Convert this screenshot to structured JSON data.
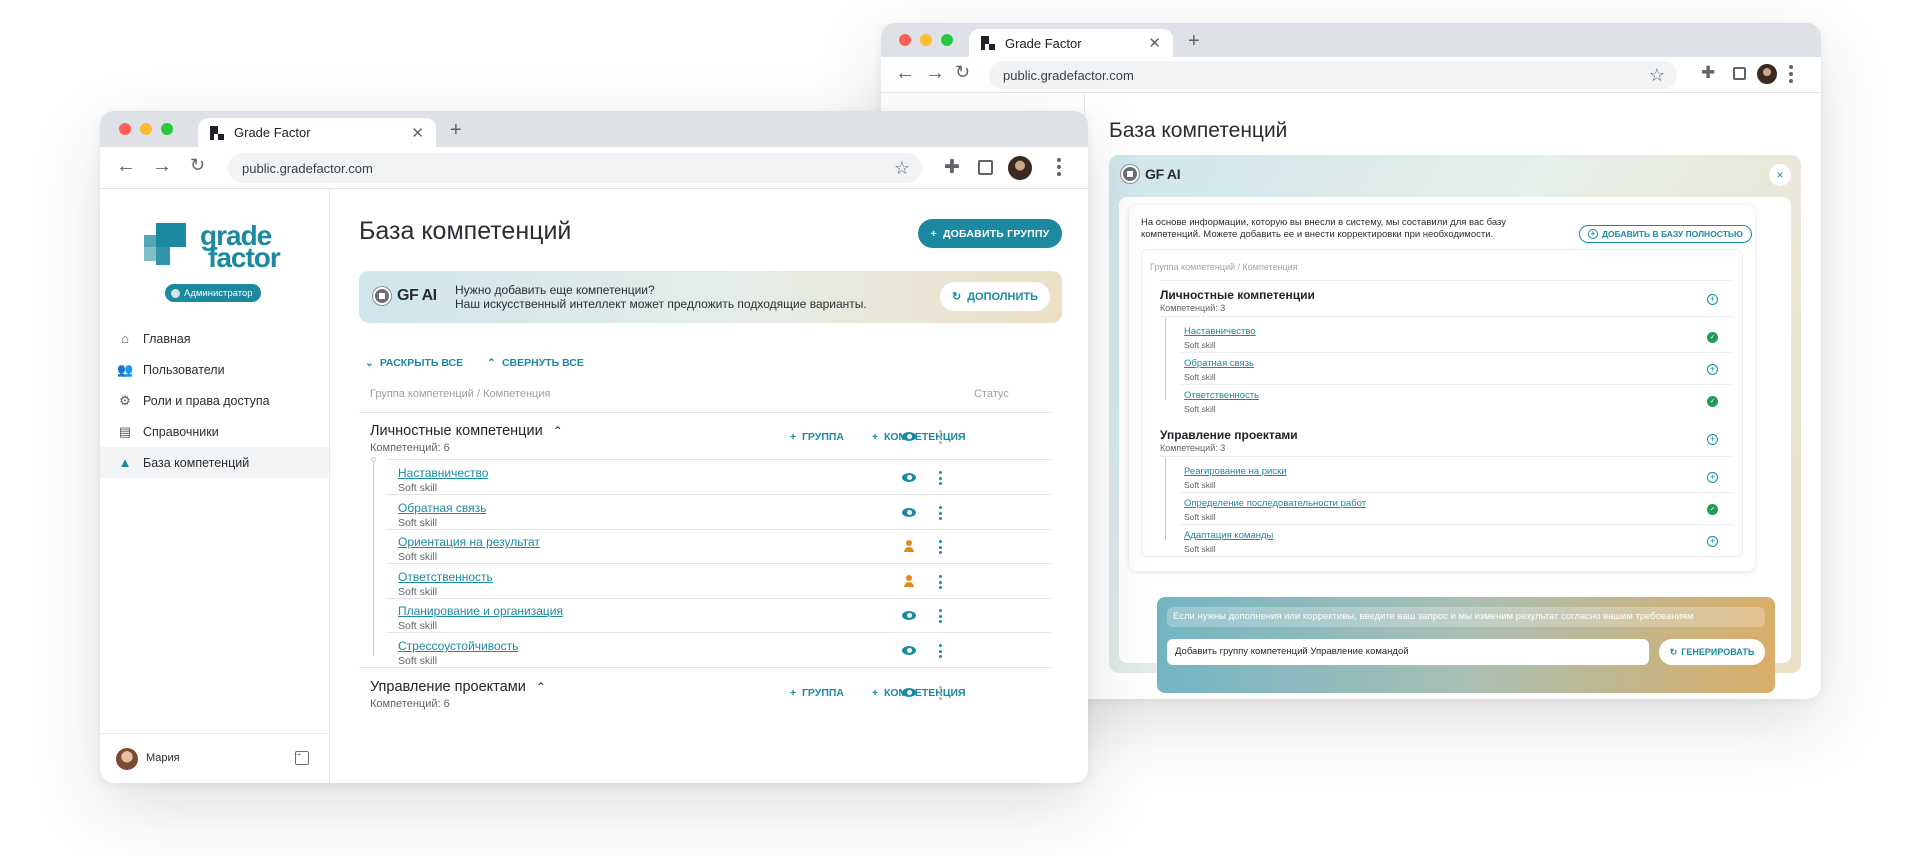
{
  "colors": {
    "accent": "#1b8aa1",
    "orange": "#e08a1e",
    "ok": "#1f9d55"
  },
  "back_window": {
    "tab_title": "Grade Factor",
    "url": "public.gradefactor.com",
    "page_title": "База компетенций",
    "ai_label": "GF AI",
    "close": "×",
    "intro": "На основе информации, которую вы внесли в систему,  мы составили для вас базу компетенций. Можете добавить ее и внести корректировки при необходимости.",
    "add_all_btn": "ДОБАВИТЬ В БАЗУ ПОЛНОСТЬЮ",
    "table_head": "Группа компетенций / Компетенция",
    "groups": [
      {
        "title": "Личностные компетенции",
        "count": "Компетенций: 3",
        "items": [
          {
            "name": "Наставничество",
            "sub": "Soft skill",
            "state": "ok"
          },
          {
            "name": "Обратная связь",
            "sub": "Soft skill",
            "state": "add"
          },
          {
            "name": "Ответственность",
            "sub": "Soft skill",
            "state": "ok"
          }
        ]
      },
      {
        "title": "Управление проектами",
        "count": "Компетенций: 3",
        "items": [
          {
            "name": "Реагирование на риски",
            "sub": "Soft skill",
            "state": "add"
          },
          {
            "name": "Определение последовательности работ",
            "sub": "Soft skill",
            "state": "ok"
          },
          {
            "name": "Адаптация команды",
            "sub": "Soft skill",
            "state": "add"
          }
        ]
      }
    ],
    "prompt_hint": "Если нужны дополнения или коррективы, введите ваш запрос и мы изменим результат согласно вашим требованиям",
    "prompt_value": "Добавить группу компетенций Управление командой",
    "generate_btn": "ГЕНЕРИРОВАТЬ"
  },
  "front_window": {
    "tab_title": "Grade Factor",
    "url": "public.gradefactor.com",
    "logo_line1": "grade",
    "logo_line2": "factor",
    "role_badge": "Администратор",
    "nav": [
      {
        "label": "Главная",
        "icon": "home-icon"
      },
      {
        "label": "Пользователи",
        "icon": "users-icon"
      },
      {
        "label": "Роли и права доступа",
        "icon": "roles-icon"
      },
      {
        "label": "Справочники",
        "icon": "book-icon"
      },
      {
        "label": "База компетенций",
        "icon": "graduation-cap-icon"
      }
    ],
    "active_nav": "База компетенций",
    "user_name": "Мария",
    "page_title": "База компетенций",
    "add_group_btn": "ДОБАВИТЬ ГРУППУ",
    "ai_label": "GF AI",
    "ai_text_1": "Нужно добавить еще компетенции?",
    "ai_text_2": "Наш искусственный интеллект может предложить подходящие варианты.",
    "supplement_btn": "ДОПОЛНИТЬ",
    "expand_all": "РАСКРЫТЬ ВСЕ",
    "collapse_all": "СВЕРНУТЬ ВСЕ",
    "col_group": "Группа компетенций / Компетенция",
    "col_status": "Статус",
    "group_btn": "ГРУППА",
    "competence_btn": "КОМПЕТЕНЦИЯ",
    "groups": [
      {
        "title": "Личностные компетенции",
        "count": "Компетенций: 6",
        "items": [
          {
            "name": "Наставничество",
            "sub": "Soft skill",
            "status": "eye-icon"
          },
          {
            "name": "Обратная связь",
            "sub": "Soft skill",
            "status": "eye-icon"
          },
          {
            "name": "Ориентация на результат",
            "sub": "Soft skill",
            "status": "person-icon"
          },
          {
            "name": "Ответственность",
            "sub": "Soft skill",
            "status": "person-icon"
          },
          {
            "name": "Планирование и организация",
            "sub": "Soft skill",
            "status": "eye-icon"
          },
          {
            "name": "Стрессоустойчивость",
            "sub": "Soft skill",
            "status": "eye-icon"
          }
        ]
      },
      {
        "title": "Управление проектами",
        "count": "Компетенций: 6",
        "items": []
      }
    ]
  }
}
